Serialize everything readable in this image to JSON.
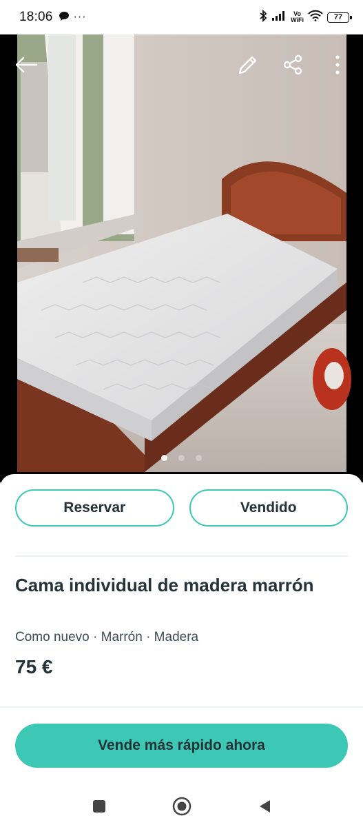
{
  "status_bar": {
    "time": "18:06",
    "extra": "···",
    "network_label": "Vo\nWiFi",
    "battery": "77"
  },
  "photo": {
    "page_count": 3,
    "active_index": 0,
    "icons": [
      "back-arrow-icon",
      "edit-pencil-icon",
      "share-icon",
      "more-vertical-icon"
    ]
  },
  "actions": {
    "reserve_label": "Reservar",
    "sold_label": "Vendido"
  },
  "product": {
    "title": "Cama individual de madera marrón",
    "attributes": "Como nuevo · Marrón · Madera",
    "price": "75 €"
  },
  "cta": {
    "label": "Vende más rápido ahora"
  },
  "colors": {
    "accent": "#3cc8b4",
    "text": "#253238"
  },
  "nav": {
    "icons": [
      "recent-apps-icon",
      "home-icon",
      "back-icon"
    ]
  }
}
